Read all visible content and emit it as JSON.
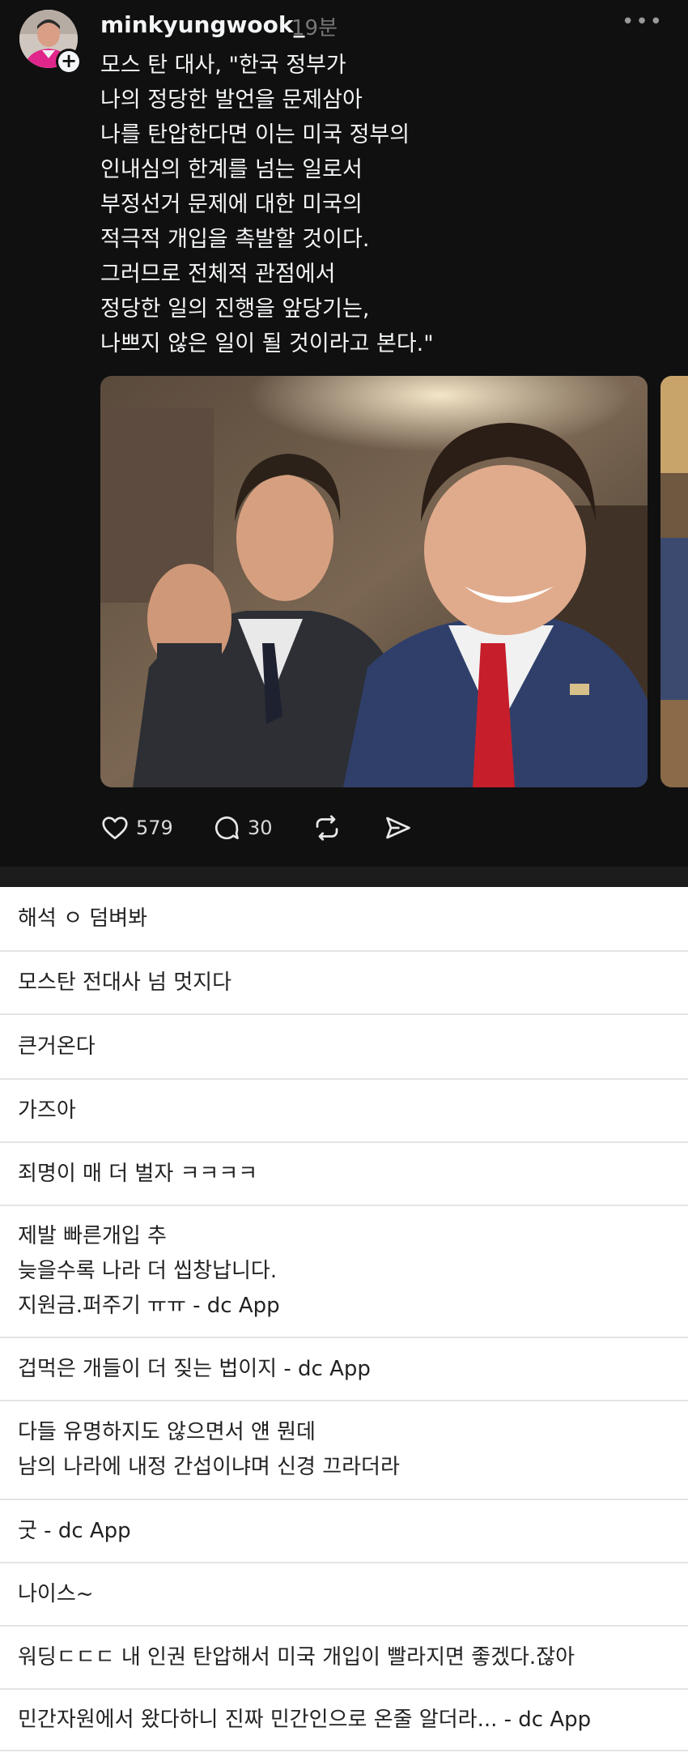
{
  "post": {
    "username": "minkyungwook_",
    "time": "19분",
    "text_lines": [
      "모스 탄 대사, \"한국 정부가",
      "나의 정당한 발언을 문제삼아",
      "나를 탄압한다면 이는 미국 정부의",
      "인내심의 한계를 넘는 일로서",
      "부정선거 문제에 대한 미국의",
      "적극적 개입을 촉발할 것이다.",
      "그러므로 전체적 관점에서",
      "정당한 일의 진행을 앞당기는,",
      "나쁘지 않은 일이 될 것이라고 본다.\""
    ],
    "likes": "579",
    "comments_count": "30",
    "icons": {
      "more": "more-icon",
      "like": "heart-icon",
      "comment": "comment-icon",
      "repost": "repost-icon",
      "share": "send-icon"
    }
  },
  "comments": [
    {
      "lines": [
        "해석 ㅇ 덤벼봐"
      ]
    },
    {
      "lines": [
        "모스탄 전대사 넘 멋지다"
      ]
    },
    {
      "lines": [
        "큰거온다"
      ]
    },
    {
      "lines": [
        "가즈아"
      ]
    },
    {
      "lines": [
        "죄명이 매 더 벌자 ㅋㅋㅋㅋ"
      ]
    },
    {
      "lines": [
        "제발 빠른개입 추",
        "늦을수록 나라 더 씹창납니다.",
        "지원금.퍼주기 ㅠㅠ - dc App"
      ]
    },
    {
      "lines": [
        "겁먹은 개들이 더 짖는 법이지 - dc App"
      ]
    },
    {
      "lines": [
        "다들 유명하지도 않으면서 얜 뭔데",
        "남의 나라에 내정 간섭이냐며 신경 끄라더라"
      ]
    },
    {
      "lines": [
        "굿 - dc App"
      ]
    },
    {
      "lines": [
        "나이스~"
      ]
    },
    {
      "lines": [
        "워딩ㄷㄷㄷ 내 인권 탄압해서 미국 개입이 빨라지면 좋겠다.잖아"
      ]
    },
    {
      "lines": [
        "민간자원에서 왔다하니 진짜 민간인으로 온줄 알더라... - dc App"
      ]
    }
  ]
}
